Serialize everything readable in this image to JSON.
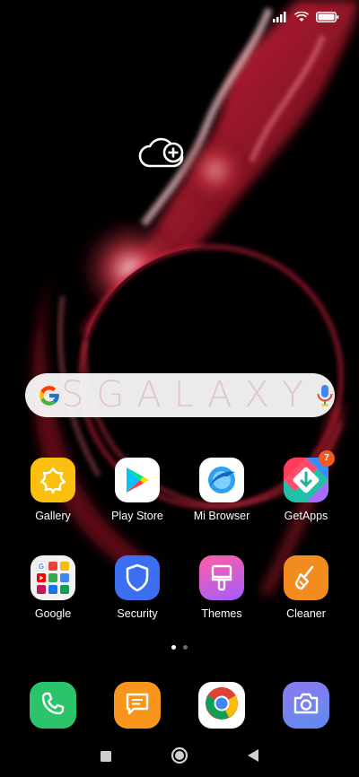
{
  "status_bar": {
    "signal_icon": "signal-icon",
    "wifi_icon": "wifi-icon",
    "battery_icon": "battery-icon"
  },
  "widgets": {
    "cloud_icon": "cloud-add-icon"
  },
  "search": {
    "logo": "google-g-icon",
    "watermark": "SGALAXY",
    "mic_icon": "mic-icon"
  },
  "apps": [
    {
      "label": "Gallery",
      "icon": "gallery-icon"
    },
    {
      "label": "Play Store",
      "icon": "play-store-icon"
    },
    {
      "label": "Mi Browser",
      "icon": "mi-browser-icon"
    },
    {
      "label": "GetApps",
      "icon": "getapps-icon",
      "badge": "7"
    },
    {
      "label": "Google",
      "icon": "google-folder-icon"
    },
    {
      "label": "Security",
      "icon": "security-shield-icon"
    },
    {
      "label": "Themes",
      "icon": "themes-brush-icon"
    },
    {
      "label": "Cleaner",
      "icon": "cleaner-broom-icon"
    }
  ],
  "page_indicator": {
    "pages": 2,
    "current": 1,
    "active_color": "#ffffff",
    "inactive_color": "#6b6b6b"
  },
  "dock": [
    {
      "name": "phone",
      "icon": "phone-icon",
      "color": "#2bc46a"
    },
    {
      "name": "messages",
      "icon": "message-icon",
      "color": "#f7961b"
    },
    {
      "name": "chrome",
      "icon": "chrome-icon",
      "color": "#ffffff"
    },
    {
      "name": "camera",
      "icon": "camera-icon",
      "color": "#7a7fe6"
    }
  ],
  "nav": {
    "recents_icon": "square-icon",
    "home_icon": "circle-icon",
    "back_icon": "triangle-back-icon"
  }
}
